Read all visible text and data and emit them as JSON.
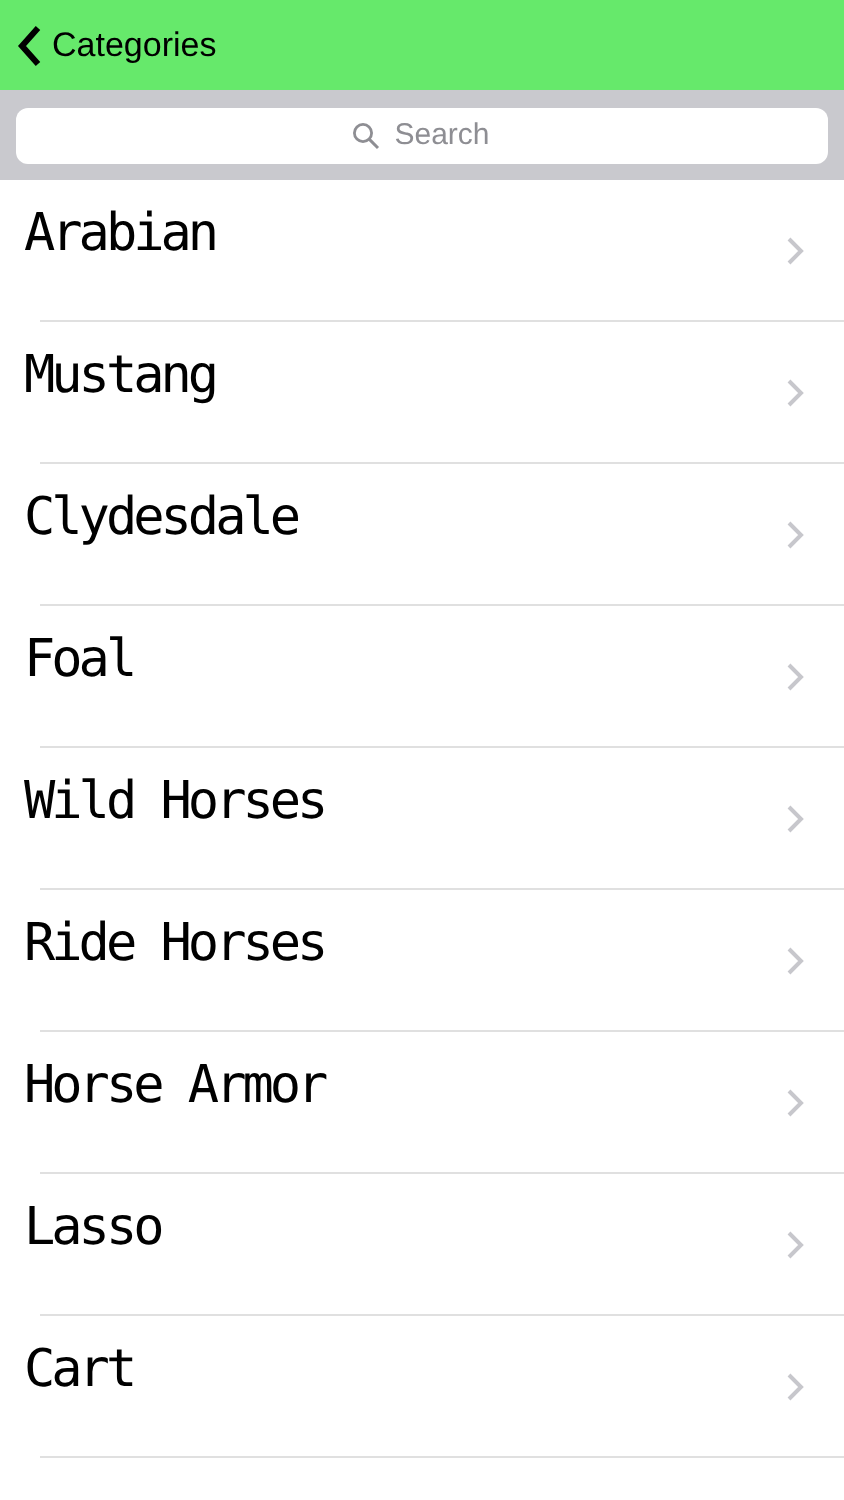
{
  "nav": {
    "back_label": "Categories"
  },
  "search": {
    "placeholder": "Search"
  },
  "items": [
    {
      "label": "Arabian"
    },
    {
      "label": "Mustang"
    },
    {
      "label": "Clydesdale"
    },
    {
      "label": "Foal"
    },
    {
      "label": "Wild Horses"
    },
    {
      "label": "Ride Horses"
    },
    {
      "label": "Horse Armor"
    },
    {
      "label": "Lasso"
    },
    {
      "label": "Cart"
    }
  ]
}
